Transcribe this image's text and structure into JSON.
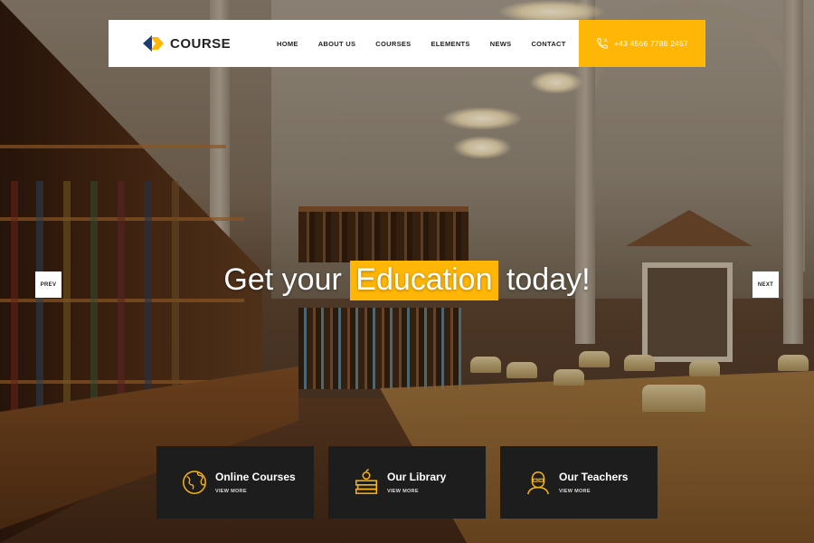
{
  "brand": {
    "name": "COURSE"
  },
  "nav": {
    "items": [
      {
        "label": "HOME"
      },
      {
        "label": "ABOUT US"
      },
      {
        "label": "COURSES"
      },
      {
        "label": "ELEMENTS"
      },
      {
        "label": "NEWS"
      },
      {
        "label": "CONTACT"
      }
    ]
  },
  "phone": {
    "number": "+43 4566 7788 2457",
    "icon": "phone-icon"
  },
  "slider": {
    "headline_before": "Get your",
    "headline_highlight": "Education",
    "headline_after": "today!",
    "prev_label": "PREV",
    "next_label": "NEXT"
  },
  "features": [
    {
      "title": "Online Courses",
      "more": "VIEW MORE",
      "icon": "globe-icon"
    },
    {
      "title": "Our Library",
      "more": "VIEW MORE",
      "icon": "books-icon"
    },
    {
      "title": "Our Teachers",
      "more": "VIEW MORE",
      "icon": "teacher-icon"
    }
  ],
  "colors": {
    "accent": "#ffb606",
    "dark_box": "#1d1d1d",
    "header_bg": "#ffffff",
    "brand_blue": "#1f3a78"
  }
}
